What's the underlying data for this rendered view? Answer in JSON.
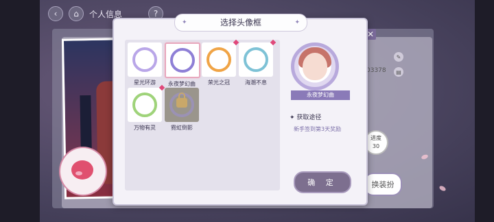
{
  "topbar": {
    "back_icon": "back-arrow-icon",
    "home_icon": "home-icon",
    "title": "个人信息",
    "help": "?"
  },
  "dialog": {
    "title": "选择头像框",
    "frames": [
      {
        "label": "星光环游",
        "ring_color": "#b9a6e8",
        "new": false,
        "selected": false,
        "locked": false
      },
      {
        "label": "永夜梦幻曲",
        "ring_color": "#8e7fd6",
        "new": false,
        "selected": true,
        "locked": false
      },
      {
        "label": "荣光之冠",
        "ring_color": "#f0a446",
        "new": true,
        "selected": false,
        "locked": false
      },
      {
        "label": "海潮不息",
        "ring_color": "#7ec2d6",
        "new": true,
        "selected": false,
        "locked": false
      },
      {
        "label": "万物有灵",
        "ring_color": "#9fd37a",
        "new": true,
        "selected": false,
        "locked": false
      },
      {
        "label": "霓虹倒影",
        "ring_color": "#9c8fd6",
        "new": false,
        "selected": false,
        "locked": true
      }
    ],
    "preview_name": "永夜梦幻曲",
    "source_title": "获取途径",
    "source_text": "新手签到第3天奖励",
    "confirm_label": "确 定"
  },
  "background": {
    "id_fragment": "03378",
    "progress_label": "进度",
    "progress_value": "30",
    "change_outfit": "换装扮"
  }
}
